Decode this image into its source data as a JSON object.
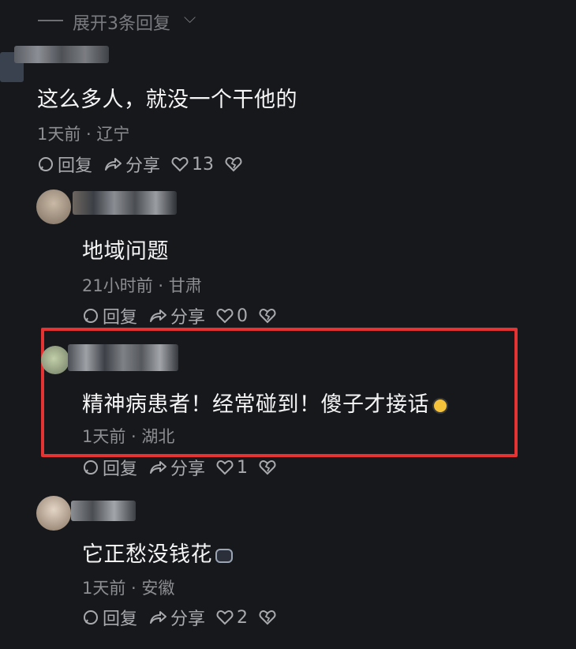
{
  "expand": {
    "label": "展开3条回复"
  },
  "comments": [
    {
      "text": "这么多人，就没一个干他的",
      "time": "1天前",
      "location": "辽宁",
      "reply_label": "回复",
      "share_label": "分享",
      "likes": "13"
    },
    {
      "text": "地域问题",
      "time": "21小时前",
      "location": "甘肃",
      "reply_label": "回复",
      "share_label": "分享",
      "likes": "0"
    },
    {
      "text": "精神病患者！经常碰到！傻子才接话",
      "time": "1天前",
      "location": "湖北",
      "reply_label": "回复",
      "share_label": "分享",
      "likes": "1"
    },
    {
      "text": "它正愁没钱花",
      "time": "1天前",
      "location": "安徽",
      "reply_label": "回复",
      "share_label": "分享",
      "likes": "2"
    }
  ],
  "colors": {
    "background": "#16181c",
    "highlight": "#e53233",
    "meta": "#8d8e92"
  }
}
